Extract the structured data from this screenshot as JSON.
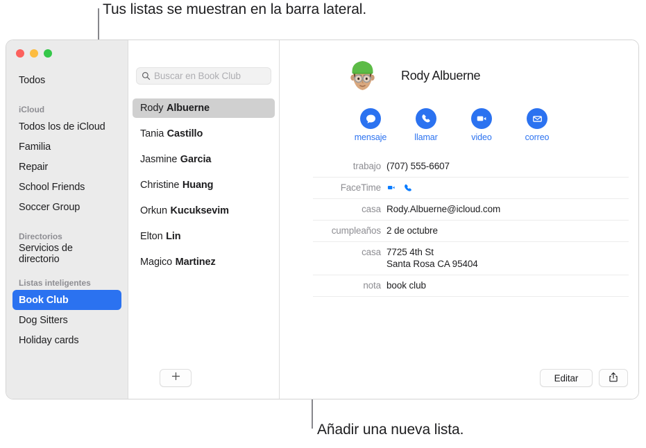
{
  "callouts": {
    "top": "Tus listas se muestran en la barra lateral.",
    "bottom": "Añadir una nueva lista."
  },
  "window": {
    "traffic_lights": {
      "close": "close-button",
      "minimize": "minimize-button",
      "zoom": "zoom-button"
    }
  },
  "sidebar": {
    "top_item": "Todos",
    "groups": [
      {
        "header": "iCloud",
        "items": [
          "Todos los de iCloud",
          "Familia",
          "Repair",
          "School Friends",
          "Soccer Group"
        ]
      },
      {
        "header": "Directorios",
        "items": [
          "Servicios de directorio"
        ]
      },
      {
        "header": "Listas inteligentes",
        "items": [
          "Book Club",
          "Dog Sitters",
          "Holiday cards"
        ]
      }
    ],
    "selected": "Book Club"
  },
  "search": {
    "placeholder": "Buscar en Book Club",
    "value": "",
    "icon": "search-icon"
  },
  "contacts": {
    "selected_index": 0,
    "items": [
      {
        "first": "Rody",
        "last": "Albuerne"
      },
      {
        "first": "Tania",
        "last": "Castillo"
      },
      {
        "first": "Jasmine",
        "last": "Garcia"
      },
      {
        "first": "Christine",
        "last": "Huang"
      },
      {
        "first": "Orkun",
        "last": "Kucuksevim"
      },
      {
        "first": "Elton",
        "last": "Lin"
      },
      {
        "first": "Magico",
        "last": "Martinez"
      }
    ]
  },
  "add_list_button": {
    "label": "+",
    "icon": "plus-icon"
  },
  "detail": {
    "name": "Rody Albuerne",
    "avatar": "memoji-avatar",
    "actions": [
      {
        "label": "mensaje",
        "icon": "message-bubble-icon"
      },
      {
        "label": "llamar",
        "icon": "phone-icon"
      },
      {
        "label": "video",
        "icon": "video-camera-icon"
      },
      {
        "label": "correo",
        "icon": "envelope-icon"
      }
    ],
    "fields": [
      {
        "label": "trabajo",
        "value": "(707) 555-6607",
        "type": "text"
      },
      {
        "label": "FaceTime",
        "value": "",
        "type": "icons",
        "icons": [
          "video-camera-icon",
          "phone-icon"
        ]
      },
      {
        "label": "casa",
        "value": "Rody.Albuerne@icloud.com",
        "type": "text"
      },
      {
        "label": "cumpleaños",
        "value": "2 de octubre",
        "type": "text"
      },
      {
        "label": "casa",
        "value": "7725 4th St\nSanta Rosa CA 95404",
        "type": "multiline",
        "line1": "7725 4th St",
        "line2": "Santa Rosa CA 95404"
      },
      {
        "label": "nota",
        "value": "book club",
        "type": "text"
      }
    ],
    "edit_label": "Editar",
    "share_icon": "share-icon"
  },
  "colors": {
    "accent": "#2b72f0",
    "sidebar_bg": "#ebebeb",
    "selection_gray": "#d0d0d0",
    "traffic_red": "#fc615d",
    "traffic_yellow": "#fdbc40",
    "traffic_green": "#34c749"
  }
}
